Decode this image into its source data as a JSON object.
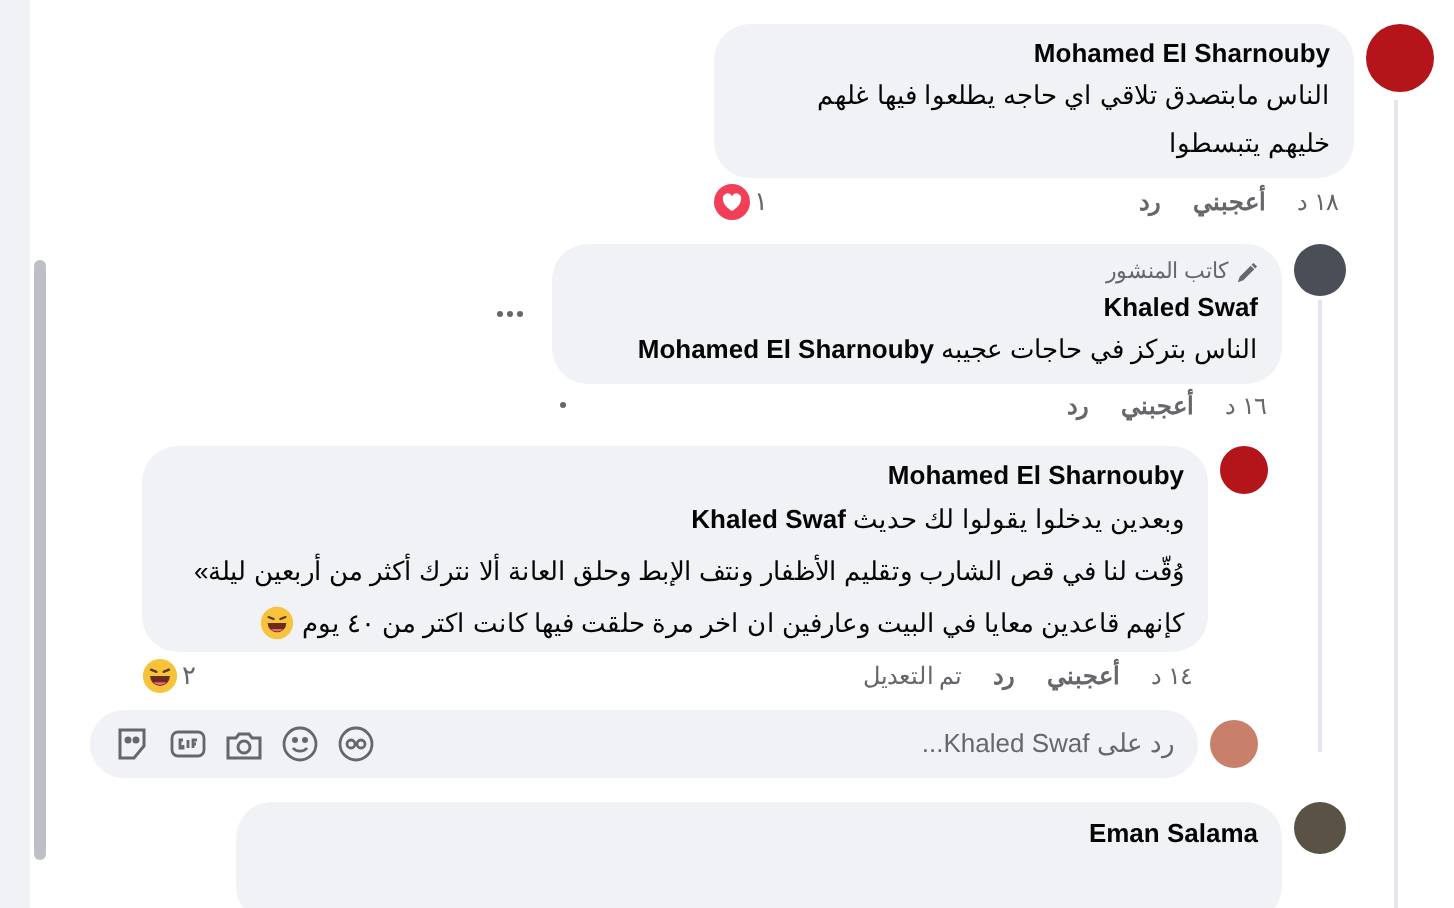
{
  "comments": [
    {
      "author": "Mohamed El Sharnouby",
      "lines": [
        "الناس مابتصدق تلاقي اي حاجه يطلعوا فيها غلهم",
        "خليهم يتبسطوا"
      ],
      "meta": {
        "time": "١٨ د",
        "like": "أعجبني",
        "reply": "رد",
        "reaction": {
          "kind": "heart",
          "count": "١"
        }
      },
      "more_options": false
    },
    {
      "author": "Khaled Swaf",
      "author_badge": "كاتب المنشور",
      "lines": [
        "الناس بتركز في حاجات عجيبه **Mohamed El Sharnouby**"
      ],
      "meta": {
        "time": "١٦ د",
        "like": "أعجبني",
        "reply": "رد"
      },
      "more_options": true
    },
    {
      "author": "Mohamed El Sharnouby",
      "lines": [
        "وبعدين يدخلوا يقولوا لك حديث **Khaled Swaf**",
        "وُقّت لنا في قص الشارب وتقليم الأظفار ونتف الإبط وحلق العانة ألا نترك أكثر من أربعين ليلة»",
        "كإنهم قاعدين معايا في البيت وعارفين ان اخر مرة حلقت فيها كانت اكتر من ٤٠ يوم"
      ],
      "meta": {
        "time": "١٤ د",
        "like": "أعجبني",
        "reply": "رد",
        "edited": "تم التعديل",
        "reaction": {
          "kind": "laugh",
          "count": "٢"
        }
      },
      "more_options": false
    }
  ],
  "reply_box": {
    "placeholder": "رد على Khaled Swaf..."
  },
  "next_comment": {
    "author": "Eman Salama"
  }
}
